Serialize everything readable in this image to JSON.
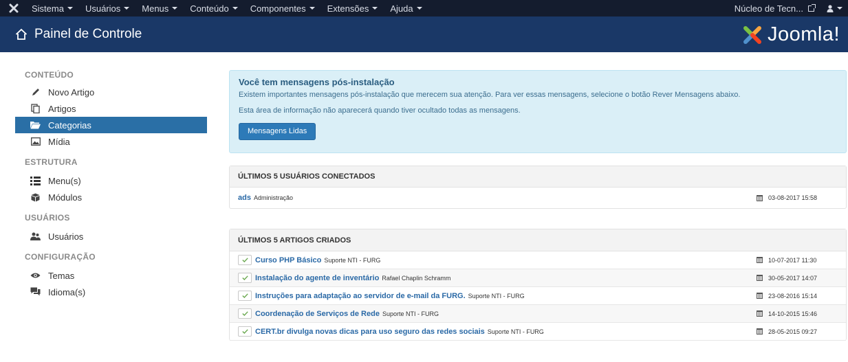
{
  "topbar": {
    "menus": [
      "Sistema",
      "Usuários",
      "Menus",
      "Conteúdo",
      "Componentes",
      "Extensões",
      "Ajuda"
    ],
    "site_link": "Núcleo de Tecn...",
    "user_icon": "user-icon"
  },
  "header": {
    "title": "Painel de Controle",
    "brand": "Joomla!",
    "brand_colors": [
      "#f9a541",
      "#f44321",
      "#5091cd",
      "#7ac143"
    ]
  },
  "sidebar": {
    "sections": [
      {
        "title": "CONTEÚDO",
        "items": [
          {
            "label": "Novo Artigo",
            "icon": "pencil-icon"
          },
          {
            "label": "Artigos",
            "icon": "stack-icon"
          },
          {
            "label": "Categorias",
            "icon": "folder-open-icon",
            "active": true
          },
          {
            "label": "Mídia",
            "icon": "image-icon"
          }
        ]
      },
      {
        "title": "ESTRUTURA",
        "items": [
          {
            "label": "Menu(s)",
            "icon": "list-icon"
          },
          {
            "label": "Módulos",
            "icon": "cube-icon"
          }
        ]
      },
      {
        "title": "USUÁRIOS",
        "items": [
          {
            "label": "Usuários",
            "icon": "users-icon"
          }
        ]
      },
      {
        "title": "CONFIGURAÇÃO",
        "items": [
          {
            "label": "Temas",
            "icon": "eye-icon"
          },
          {
            "label": "Idioma(s)",
            "icon": "comments-icon"
          }
        ]
      }
    ]
  },
  "alert": {
    "heading": "Você tem mensagens pós-instalação",
    "line1": "Existem importantes mensagens pós-instalação que merecem sua atenção. Para ver essas mensagens, selecione o botão Rever Mensagens abaixo.",
    "line2": "Esta área de informação não aparecerá quando tiver ocultado todas as mensagens.",
    "button": "Mensagens Lidas"
  },
  "users_panel": {
    "title": "ÚLTIMOS 5 USUÁRIOS CONECTADOS",
    "rows": [
      {
        "name": "ads",
        "detail": "Administração",
        "date": "03-08-2017 15:58"
      }
    ]
  },
  "articles_panel": {
    "title": "ÚLTIMOS 5 ARTIGOS CRIADOS",
    "rows": [
      {
        "title": "Curso PHP Básico",
        "author": "Suporte NTI - FURG",
        "date": "10-07-2017 11:30"
      },
      {
        "title": "Instalação do agente de inventário",
        "author": "Rafael Chaplin Schramm",
        "date": "30-05-2017 14:07"
      },
      {
        "title": "Instruções para adaptação ao servidor de e-mail da FURG.",
        "author": "Suporte NTI - FURG",
        "date": "23-08-2016 15:14"
      },
      {
        "title": "Coordenação de Serviços de Rede",
        "author": "Suporte NTI - FURG",
        "date": "14-10-2015 15:46"
      },
      {
        "title": "CERT.br divulga novas dicas para uso seguro das redes sociais",
        "author": "Suporte NTI - FURG",
        "date": "28-05-2015 09:27"
      }
    ]
  }
}
